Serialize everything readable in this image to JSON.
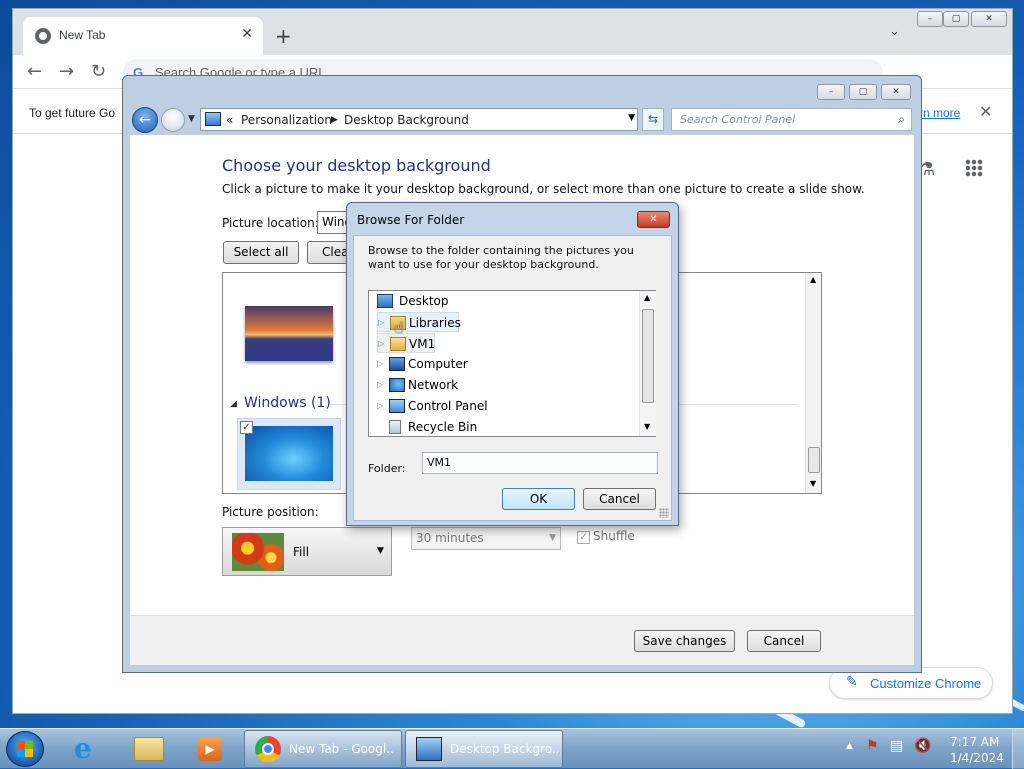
{
  "chrome": {
    "tab_title": "New Tab",
    "tab_close": "✕",
    "new_tab": "+",
    "tab_search": "⌄",
    "omnibox_g": "G",
    "omnibox_placeholder": "Search Google or type a URL",
    "info_text": "To get future Go",
    "info_link": "rn more",
    "info_close": "✕",
    "customize": "Customize Chrome",
    "window_controls": [
      "–",
      "▢",
      "✕"
    ]
  },
  "control_panel": {
    "window_controls": [
      "–",
      "▢",
      "✕"
    ],
    "breadcrumb_prefix": "«",
    "breadcrumb": [
      "Personalization",
      "Desktop Background"
    ],
    "search_placeholder": "Search Control Panel",
    "heading": "Choose your desktop background",
    "subheading": "Click a picture to make it your desktop background, or select more than one picture to create a slide show.",
    "picture_location_label": "Picture location:",
    "picture_location_value": "Wind",
    "select_all": "Select all",
    "clear_all": "Clear all",
    "group_title": "Windows (1)",
    "picture_position_label": "Picture position:",
    "picture_position_value": "Fill",
    "interval_value": "30 minutes",
    "shuffle_label": "Shuffle",
    "save": "Save changes",
    "cancel": "Cancel"
  },
  "dialog": {
    "title": "Browse For Folder",
    "description": "Browse to the folder containing the pictures you want to use for your desktop background.",
    "tree": [
      {
        "label": "Desktop",
        "icon": "desktop-icon",
        "expandable": false
      },
      {
        "label": "Libraries",
        "icon": "libraries-icon",
        "expandable": true
      },
      {
        "label": "VM1",
        "icon": "user-folder-icon",
        "expandable": true
      },
      {
        "label": "Computer",
        "icon": "computer-icon",
        "expandable": true
      },
      {
        "label": "Network",
        "icon": "network-icon",
        "expandable": true
      },
      {
        "label": "Control Panel",
        "icon": "control-panel-icon",
        "expandable": true
      },
      {
        "label": "Recycle Bin",
        "icon": "recycle-bin-icon",
        "expandable": false
      }
    ],
    "folder_label": "Folder:",
    "folder_value": "VM1",
    "ok": "OK",
    "cancel": "Cancel"
  },
  "taskbar": {
    "buttons": [
      "New Tab - Googl...",
      "Desktop Backgro..."
    ],
    "time": "7:17 AM",
    "date": "1/4/2024"
  }
}
